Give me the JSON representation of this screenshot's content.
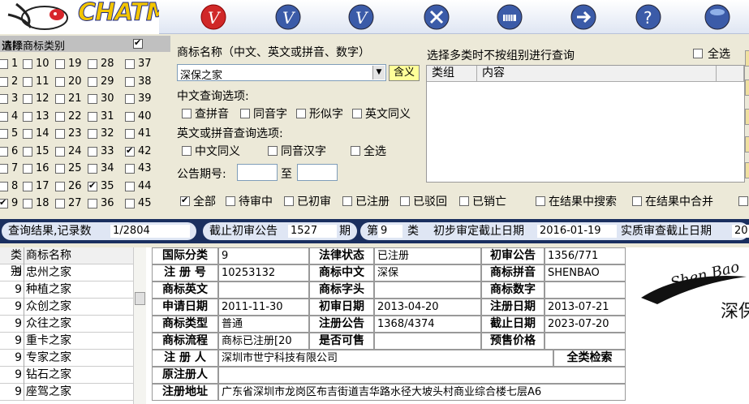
{
  "app": {
    "logo_text": "CHATM"
  },
  "toolbar": {
    "icons": [
      "v-icon-red",
      "v-icon-1",
      "v-icon-2",
      "tools-icon",
      "piano-icon",
      "arrow-right-icon",
      "help-icon",
      "sphere-icon"
    ]
  },
  "category": {
    "title": "选择商标类别",
    "clear_label": "清除",
    "numbers": [
      1,
      10,
      19,
      28,
      37,
      2,
      11,
      20,
      29,
      38,
      3,
      12,
      21,
      30,
      39,
      4,
      13,
      22,
      31,
      40,
      5,
      14,
      23,
      32,
      41,
      6,
      15,
      24,
      33,
      42,
      7,
      16,
      25,
      34,
      43,
      8,
      17,
      26,
      35,
      44,
      9,
      18,
      27,
      36,
      45
    ],
    "checked": [
      9,
      35,
      42
    ]
  },
  "search": {
    "name_label": "商标名称（中文、英文或拼音、数字）",
    "name_value": "深保之家",
    "meaning_btn": "含义",
    "cn_options_label": "中文查询选项:",
    "cn_options": [
      "查拼音",
      "同音字",
      "形似字",
      "英文同义"
    ],
    "en_options_label": "英文或拼音查询选项:",
    "en_options": [
      "中文同义",
      "同音汉字",
      "全选"
    ],
    "issue_label": "公告期号:",
    "issue_to": "至"
  },
  "multi": {
    "title": "选择多类时不按组别进行查询",
    "select_all": "全选",
    "col_group": "类组",
    "col_content": "内容"
  },
  "status_filters": {
    "all": "全部",
    "pending": "待审中",
    "prelim": "已初审",
    "registered": "已注册",
    "rejected": "已驳回",
    "cancelled": "已销亡",
    "search_in": "在结果中搜索",
    "merge_in": "在结果中合并"
  },
  "results": {
    "label": "查询结果,记录数",
    "count": "1/2804",
    "deadline_label": "截止初审公告",
    "deadline_value": "1527",
    "deadline_unit": "期",
    "class_prefix": "第",
    "class_value": "9",
    "class_unit": "类",
    "prelim_label": "初步审定截止日期",
    "prelim_value": "2016-01-19",
    "exam_label": "实质审查截止日期",
    "exam_value": "20"
  },
  "list": {
    "col_class": "类别",
    "col_name": "商标名称",
    "rows": [
      {
        "c": "9",
        "n": "忠州之家"
      },
      {
        "c": "9",
        "n": "种植之家"
      },
      {
        "c": "9",
        "n": "众创之家"
      },
      {
        "c": "9",
        "n": "众往之家"
      },
      {
        "c": "9",
        "n": "重卡之家"
      },
      {
        "c": "9",
        "n": "专家之家"
      },
      {
        "c": "9",
        "n": "钻石之家"
      },
      {
        "c": "9",
        "n": "座驾之家"
      }
    ]
  },
  "detail": {
    "intl_class_k": "国际分类",
    "intl_class_v": "9",
    "legal_k": "法律状态",
    "legal_v": "已注册",
    "prelim_k": "初审公告",
    "prelim_v": "1356/771",
    "regno_k": "注 册 号",
    "regno_v": "10253132",
    "cn_k": "商标中文",
    "cn_v": "深保",
    "py_k": "商标拼音",
    "py_v": "SHENBAO",
    "en_k": "商标英文",
    "en_v": "",
    "head_k": "商标字头",
    "head_v": "",
    "num_k": "商标数字",
    "num_v": "",
    "apply_k": "申请日期",
    "apply_v": "2011-11-30",
    "pdate_k": "初审日期",
    "pdate_v": "2013-04-20",
    "rdate_k": "注册日期",
    "rdate_v": "2013-07-21",
    "type_k": "商标类型",
    "type_v": "普通",
    "reg_notice_k": "注册公告",
    "reg_notice_v": "1368/4374",
    "end_k": "截止日期",
    "end_v": "2023-07-20",
    "flow_k": "商标流程",
    "flow_v": "商标已注册[20",
    "sale_k": "是否可售",
    "sale_v": "",
    "price_k": "预售价格",
    "price_v": "",
    "reg_k": "注 册 人",
    "reg_v": "深圳市世宁科技有限公司",
    "all_search": "全类检索",
    "orig_k": "原注册人",
    "orig_v": "",
    "addr_k": "注册地址",
    "addr_v": "广东省深圳市龙岗区布吉街道吉华路水径大坡头村商业综合楼七层A6"
  },
  "brand": {
    "logo": "Shen Bao",
    "logo_cn": "深保"
  }
}
